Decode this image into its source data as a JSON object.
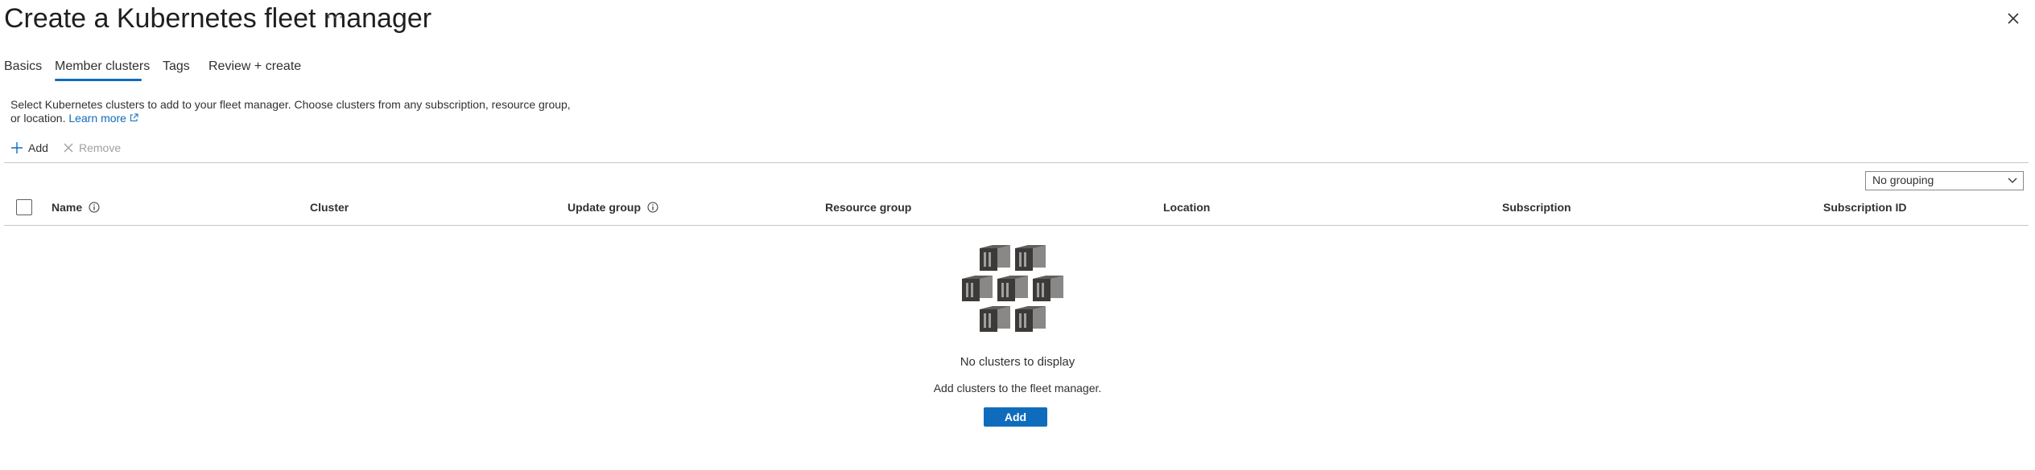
{
  "header": {
    "title": "Create a Kubernetes fleet manager",
    "more_label": "···",
    "close_icon": "close-icon"
  },
  "tabs": [
    {
      "label": "Basics",
      "active": false
    },
    {
      "label": "Member clusters",
      "active": true
    },
    {
      "label": "Tags",
      "active": false
    },
    {
      "label": "Review + create",
      "active": false
    }
  ],
  "description": {
    "text": "Select Kubernetes clusters to add to your fleet manager. Choose clusters from any subscription, resource group, or location.",
    "link_label": "Learn more"
  },
  "toolbar": {
    "add_label": "Add",
    "remove_label": "Remove"
  },
  "grouping": {
    "selected": "No grouping"
  },
  "table": {
    "columns": [
      "Name",
      "Cluster",
      "Update group",
      "Resource group",
      "Location",
      "Subscription",
      "Subscription ID"
    ]
  },
  "empty_state": {
    "title": "No clusters to display",
    "subtitle": "Add clusters to the fleet manager.",
    "button_label": "Add"
  },
  "colors": {
    "accent": "#0f6cbd",
    "text": "#323130",
    "divider": "#c8c6c4"
  }
}
